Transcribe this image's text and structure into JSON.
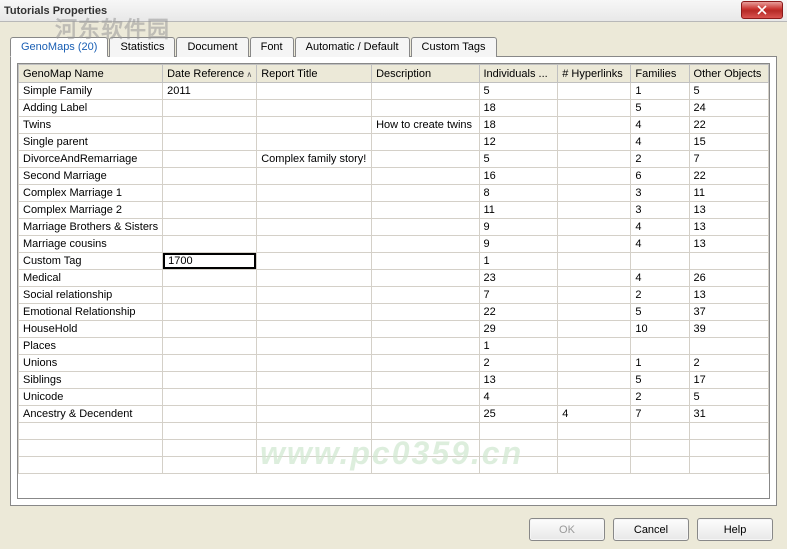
{
  "window": {
    "title": "Tutorials Properties"
  },
  "watermarks": {
    "w1": "河东软件园",
    "w2": "www.pc0359.cn"
  },
  "tabs": [
    {
      "label": "GenoMaps (20)",
      "active": true
    },
    {
      "label": "Statistics",
      "active": false
    },
    {
      "label": "Document",
      "active": false
    },
    {
      "label": "Font",
      "active": false
    },
    {
      "label": "Automatic / Default",
      "active": false
    },
    {
      "label": "Custom Tags",
      "active": false
    }
  ],
  "columns": [
    {
      "label": "GenoMap Name",
      "cls": "col-name"
    },
    {
      "label": "Date Reference",
      "cls": "col-date",
      "sort": true
    },
    {
      "label": "Report Title",
      "cls": "col-report"
    },
    {
      "label": "Description",
      "cls": "col-desc"
    },
    {
      "label": "Individuals ...",
      "cls": "col-ind"
    },
    {
      "label": "# Hyperlinks",
      "cls": "col-hyp"
    },
    {
      "label": "Families",
      "cls": "col-fam"
    },
    {
      "label": "Other Objects",
      "cls": "col-oth"
    }
  ],
  "rows": [
    {
      "name": "Simple Family",
      "date": "2011",
      "report": "",
      "desc": "",
      "ind": "5",
      "hyp": "",
      "fam": "1",
      "oth": "5"
    },
    {
      "name": "Adding Label",
      "date": "",
      "report": "",
      "desc": "",
      "ind": "18",
      "hyp": "",
      "fam": "5",
      "oth": "24"
    },
    {
      "name": "Twins",
      "date": "",
      "report": "",
      "desc": "How to create twins",
      "ind": "18",
      "hyp": "",
      "fam": "4",
      "oth": "22"
    },
    {
      "name": "Single parent",
      "date": "",
      "report": "",
      "desc": "",
      "ind": "12",
      "hyp": "",
      "fam": "4",
      "oth": "15"
    },
    {
      "name": "DivorceAndRemarriage",
      "date": "",
      "report": "Complex family story!",
      "desc": "",
      "ind": "5",
      "hyp": "",
      "fam": "2",
      "oth": "7"
    },
    {
      "name": "Second Marriage",
      "date": "",
      "report": "",
      "desc": "",
      "ind": "16",
      "hyp": "",
      "fam": "6",
      "oth": "22"
    },
    {
      "name": "Complex Marriage 1",
      "date": "",
      "report": "",
      "desc": "",
      "ind": "8",
      "hyp": "",
      "fam": "3",
      "oth": "11"
    },
    {
      "name": "Complex Marriage 2",
      "date": "",
      "report": "",
      "desc": "",
      "ind": "11",
      "hyp": "",
      "fam": "3",
      "oth": "13"
    },
    {
      "name": "Marriage Brothers & Sisters",
      "date": "",
      "report": "",
      "desc": "",
      "ind": "9",
      "hyp": "",
      "fam": "4",
      "oth": "13"
    },
    {
      "name": "Marriage cousins",
      "date": "",
      "report": "",
      "desc": "",
      "ind": "9",
      "hyp": "",
      "fam": "4",
      "oth": "13"
    },
    {
      "name": "Custom Tag",
      "date": "1700",
      "report": "",
      "desc": "",
      "ind": "1",
      "hyp": "",
      "fam": "",
      "oth": "",
      "editing": true
    },
    {
      "name": "Medical",
      "date": "",
      "report": "",
      "desc": "",
      "ind": "23",
      "hyp": "",
      "fam": "4",
      "oth": "26"
    },
    {
      "name": "Social relationship",
      "date": "",
      "report": "",
      "desc": "",
      "ind": "7",
      "hyp": "",
      "fam": "2",
      "oth": "13"
    },
    {
      "name": "Emotional Relationship",
      "date": "",
      "report": "",
      "desc": "",
      "ind": "22",
      "hyp": "",
      "fam": "5",
      "oth": "37"
    },
    {
      "name": "HouseHold",
      "date": "",
      "report": "",
      "desc": "",
      "ind": "29",
      "hyp": "",
      "fam": "10",
      "oth": "39"
    },
    {
      "name": "Places",
      "date": "",
      "report": "",
      "desc": "",
      "ind": "1",
      "hyp": "",
      "fam": "",
      "oth": ""
    },
    {
      "name": "Unions",
      "date": "",
      "report": "",
      "desc": "",
      "ind": "2",
      "hyp": "",
      "fam": "1",
      "oth": "2"
    },
    {
      "name": "Siblings",
      "date": "",
      "report": "",
      "desc": "",
      "ind": "13",
      "hyp": "",
      "fam": "5",
      "oth": "17"
    },
    {
      "name": "Unicode",
      "date": "",
      "report": "",
      "desc": "",
      "ind": "4",
      "hyp": "",
      "fam": "2",
      "oth": "5"
    },
    {
      "name": "Ancestry & Decendent",
      "date": "",
      "report": "",
      "desc": "",
      "ind": "25",
      "hyp": "4",
      "fam": "7",
      "oth": "31"
    }
  ],
  "buttons": {
    "ok": "OK",
    "cancel": "Cancel",
    "help": "Help"
  }
}
